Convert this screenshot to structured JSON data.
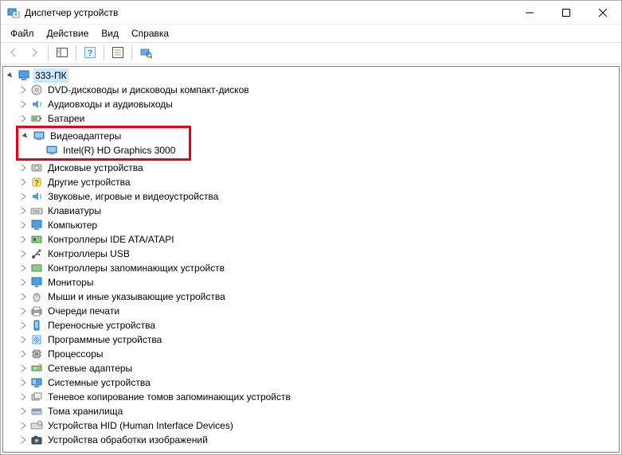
{
  "window": {
    "title": "Диспетчер устройств"
  },
  "menu": {
    "file": "Файл",
    "action": "Действие",
    "view": "Вид",
    "help": "Справка"
  },
  "tree": {
    "root": "333-ПК",
    "nodes": {
      "dvd": "DVD-дисководы и дисководы компакт-дисков",
      "audio": "Аудиовходы и аудиовыходы",
      "battery": "Батареи",
      "display_adapters": "Видеоадаптеры",
      "gpu0": "Intel(R) HD Graphics 3000",
      "disk": "Дисковые устройства",
      "other": "Другие устройства",
      "sound": "Звуковые, игровые и видеоустройства",
      "keyboard": "Клавиатуры",
      "computer": "Компьютер",
      "ide": "Контроллеры IDE ATA/ATAPI",
      "usb": "Контроллеры USB",
      "storage_ctrl": "Контроллеры запоминающих устройств",
      "monitor": "Мониторы",
      "mouse": "Мыши и иные указывающие устройства",
      "printq": "Очереди печати",
      "portable": "Переносные устройства",
      "software": "Программные устройства",
      "cpu": "Процессоры",
      "network": "Сетевые адаптеры",
      "system": "Системные устройства",
      "shadow": "Теневое копирование томов запоминающих устройств",
      "volumes": "Тома хранилища",
      "hid": "Устройства HID (Human Interface Devices)",
      "imaging": "Устройства обработки изображений"
    }
  }
}
